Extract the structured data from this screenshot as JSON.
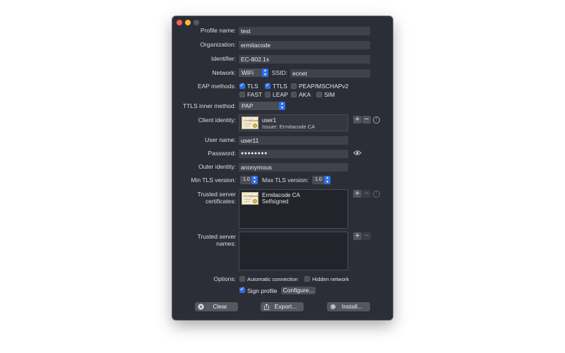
{
  "form": {
    "profile_name": {
      "label": "Profile name:",
      "value": "test"
    },
    "organization": {
      "label": "Organization:",
      "value": "ermitacode"
    },
    "identifier": {
      "label": "Identifier:",
      "value": "EC-802.1x"
    },
    "network": {
      "label": "Network:",
      "value": "WiFi",
      "ssid_label": "SSID:",
      "ssid_value": "ecnet"
    },
    "eap": {
      "label": "EAP methods:",
      "methods": [
        {
          "label": "TLS",
          "checked": true
        },
        {
          "label": "TTLS",
          "checked": true
        },
        {
          "label": "PEAP/MSCHAPv2",
          "checked": false
        },
        {
          "label": "FAST",
          "checked": false
        },
        {
          "label": "LEAP",
          "checked": false
        },
        {
          "label": "AKA",
          "checked": false
        },
        {
          "label": "SIM",
          "checked": false
        }
      ]
    },
    "ttls_inner": {
      "label": "TTLS inner method:",
      "value": "PAP"
    },
    "client_identity": {
      "label": "Client identity:",
      "name": "user1",
      "issuer": "Issuer: Ermitacode CA"
    },
    "user_name": {
      "label": "User name:",
      "value": "user11"
    },
    "password": {
      "label": "Password:",
      "value": "●●●●●●●●"
    },
    "outer_identity": {
      "label": "Outer identity:",
      "value": "anonymous"
    },
    "tls": {
      "min_label": "Min TLS version:",
      "min_value": "1.0",
      "max_label": "Max TLS version:",
      "max_value": "1.0"
    },
    "trusted_certs": {
      "label_1": "Trusted server",
      "label_2": "certificates:",
      "name": "Ermitacode CA",
      "sub": "Selfsigned"
    },
    "trusted_names": {
      "label_1": "Trusted server",
      "label_2": "names:"
    },
    "options": {
      "label": "Options:",
      "auto_connect": "Automatic connection",
      "hidden_network": "Hidden network",
      "sign_profile": "Sign profile",
      "configure": "Configure..."
    }
  },
  "buttons": {
    "clear": "Clear",
    "export": "Export...",
    "install": "Install..."
  },
  "icons": {
    "plus": "+",
    "minus": "−",
    "info": "i",
    "eye": "👁",
    "cert_text": "Certificate"
  },
  "colors": {
    "accent": "#2f6ee6",
    "window_bg": "#2c2e37",
    "field_bg": "#40424b"
  }
}
